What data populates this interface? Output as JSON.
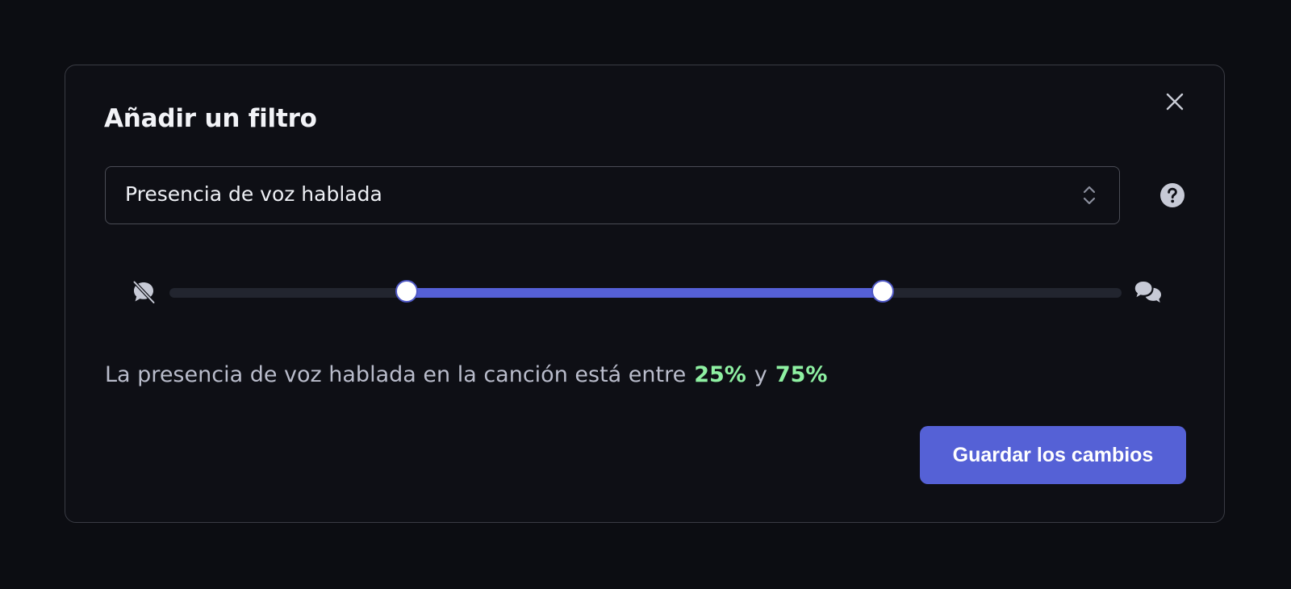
{
  "dialog": {
    "title": "Añadir un filtro",
    "close_icon": "close-icon"
  },
  "filter_select": {
    "value": "Presencia de voz hablada",
    "chevron_icon": "chevron-up-down-icon"
  },
  "help_icon": "help-circle-icon",
  "slider": {
    "min_icon": "no-speech-icon",
    "max_icon": "speech-bubbles-icon",
    "low_value": 25,
    "high_value": 75,
    "range_color": "#5560d6",
    "track_color": "#22252f"
  },
  "summary": {
    "text": "La presencia de voz hablada en la canción está entre",
    "low_label": "25%",
    "connector": "y",
    "high_label": "75%",
    "value_color": "#8ef0a2"
  },
  "save_button": {
    "label": "Guardar los cambios",
    "color": "#5561d6"
  }
}
